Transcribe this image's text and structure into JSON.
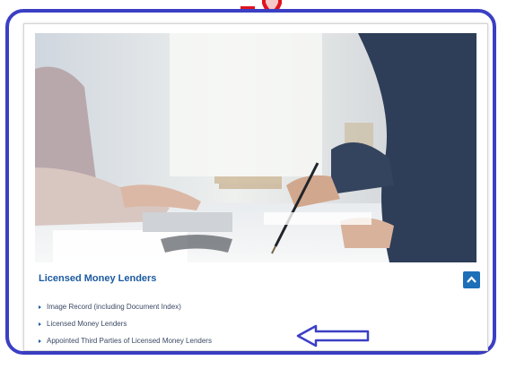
{
  "section": {
    "title": "Licensed Money Lenders"
  },
  "links": [
    {
      "label": "Image Record (including Document Index)"
    },
    {
      "label": "Licensed Money Lenders"
    },
    {
      "label": "Appointed Third Parties of Licensed Money Lenders"
    }
  ],
  "icons": {
    "collapse": "chevron-up-icon",
    "bullet": "triangle-right-icon",
    "annotation": "arrow-left-icon"
  },
  "colors": {
    "frame": "#3b3fc4",
    "marker": "#e0141e",
    "title": "#1c5aa0",
    "button": "#1d6fb8"
  }
}
